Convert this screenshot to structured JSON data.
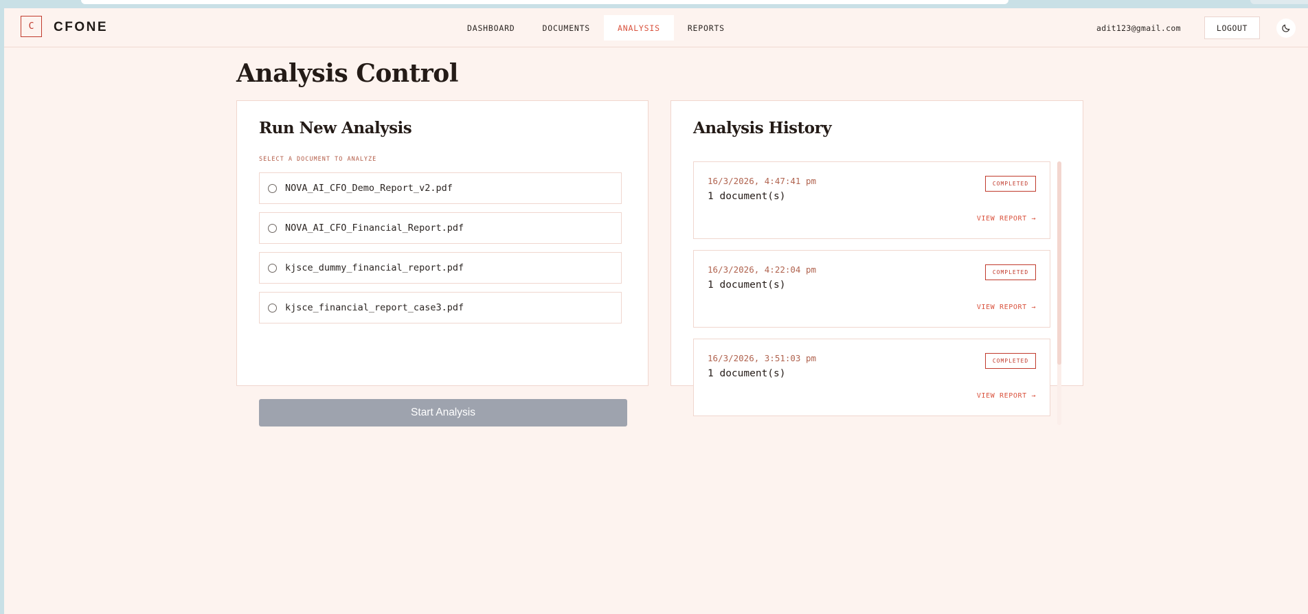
{
  "header": {
    "logo_letter": "C",
    "brand": "CFONE",
    "nav": [
      {
        "label": "DASHBOARD",
        "active": false
      },
      {
        "label": "DOCUMENTS",
        "active": false
      },
      {
        "label": "ANALYSIS",
        "active": true
      },
      {
        "label": "REPORTS",
        "active": false
      }
    ],
    "user_email": "adit123@gmail.com",
    "logout_label": "LOGOUT",
    "theme_icon": "moon-icon"
  },
  "page": {
    "title": "Analysis Control"
  },
  "run_panel": {
    "title": "Run New Analysis",
    "select_label": "SELECT A DOCUMENT TO ANALYZE",
    "documents": [
      "NOVA_AI_CFO_Demo_Report_v2.pdf",
      "NOVA_AI_CFO_Financial_Report.pdf",
      "kjsce_dummy_financial_report.pdf",
      "kjsce_financial_report_case3.pdf"
    ],
    "start_label": "Start Analysis",
    "start_disabled_color": "#9ea3ae"
  },
  "history_panel": {
    "title": "Analysis History",
    "items": [
      {
        "date": "16/3/2026, 4:47:41 pm",
        "count": "1 document(s)",
        "status": "COMPLETED",
        "link": "VIEW REPORT →"
      },
      {
        "date": "16/3/2026, 4:22:04 pm",
        "count": "1 document(s)",
        "status": "COMPLETED",
        "link": "VIEW REPORT →"
      },
      {
        "date": "16/3/2026, 3:51:03 pm",
        "count": "1 document(s)",
        "status": "COMPLETED",
        "link": "VIEW REPORT →"
      }
    ]
  },
  "colors": {
    "accent": "#d9513c",
    "brand_red": "#c0392b",
    "background": "#fdf3ef"
  }
}
